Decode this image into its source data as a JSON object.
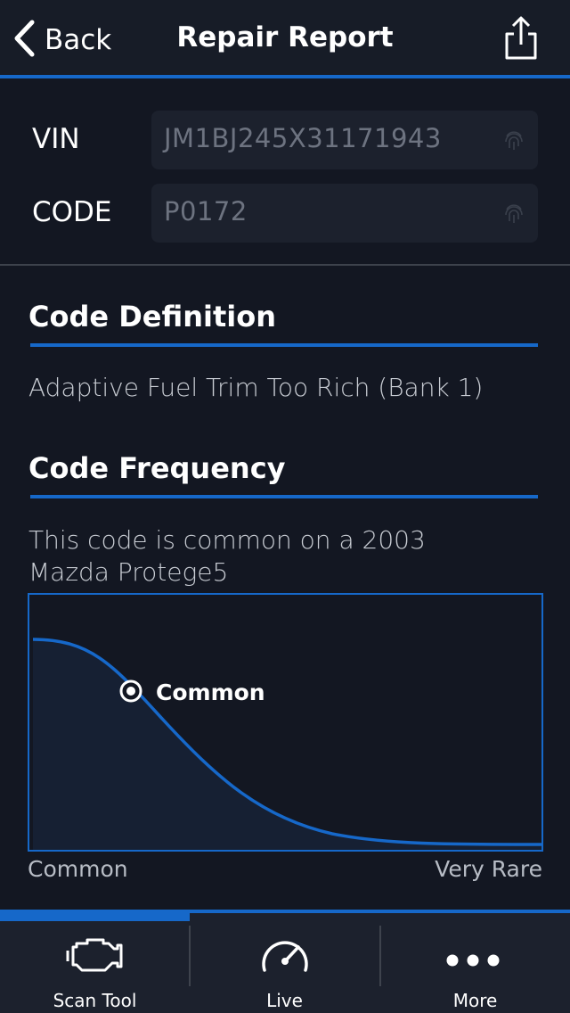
{
  "navbar": {
    "back_label": "Back",
    "title": "Repair Report",
    "back_icon": "chevron-left-icon",
    "share_icon": "share-icon"
  },
  "form": {
    "vin": {
      "label": "VIN",
      "value": "JM1BJ245X31171943",
      "icon": "fingerprint-icon"
    },
    "code": {
      "label": "CODE",
      "value": "P0172",
      "icon": "fingerprint-icon"
    }
  },
  "sections": {
    "definition": {
      "title": "Code Definition",
      "text": "Adaptive Fuel Trim Too Rich (Bank 1)"
    },
    "frequency": {
      "title": "Code Frequency",
      "text": "This code is common on a 2003 Mazda Protege5",
      "marker_label": "Common",
      "axis_left": "Common",
      "axis_right": "Very Rare"
    }
  },
  "tabs": [
    {
      "label": "Scan Tool",
      "icon": "engine-icon",
      "active": true
    },
    {
      "label": "Live",
      "icon": "gauge-icon",
      "active": false
    },
    {
      "label": "More",
      "icon": "more-dots-icon",
      "active": false
    }
  ],
  "colors": {
    "accent": "#1668c9",
    "background": "#131722",
    "field_background": "#1c212d"
  }
}
